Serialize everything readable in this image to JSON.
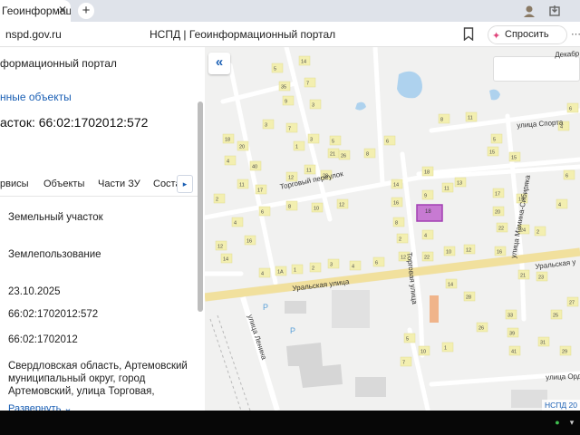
{
  "browser": {
    "tab_title": "Геоинформаци",
    "tab_close": "✕",
    "new_tab": "+",
    "url": "nspd.gov.ru",
    "page_title": "НСПД | Геоинформационный портал",
    "ask_label": "Спросить",
    "icons": [
      "profile-icon",
      "download-icon",
      "bookmark-icon",
      "assistant-icon"
    ]
  },
  "panel": {
    "portal_title": "формационный портал",
    "selected_link": "нные объекты",
    "title": "асток: 66:02:1702012:572",
    "tabs": [
      "рвисы",
      "Объекты",
      "Части ЗУ",
      "Соста"
    ],
    "tabs_more": "▸",
    "fields": {
      "type": "Земельный участок",
      "kind": "Землепользование",
      "date": "23.10.2025",
      "cadastral_number": "66:02:1702012:572",
      "quarter": "66:02:1702012",
      "address": "Свердловская область, Артемовский муниципальный округ, город Артемовский, улица Торговая,"
    },
    "expand_label": "Развернуть ⌄"
  },
  "map": {
    "collapse_label": "«",
    "footer": "НСПД 20",
    "streets": {
      "trade_lane": "Торговый переулок",
      "sport": "улица Спорта",
      "mamin": "улица Мамина-Сибиряка",
      "ural_left": "Уральская улица",
      "ural_right": "Уральская у",
      "trade_street": "Торговая улица",
      "lenin": "улица Ленина",
      "ordzh": "улица Орд",
      "dekabr": "Декабр"
    },
    "parcel_label": "18",
    "building_labels": [
      "5",
      "14",
      "35",
      "7",
      "9",
      "3",
      "3",
      "7",
      "1",
      "3",
      "5",
      "21",
      "4",
      "40",
      "11",
      "17",
      "12",
      "11",
      "28",
      "26",
      "8",
      "6",
      "8",
      "11",
      "5",
      "15",
      "6",
      "4",
      "2",
      "4",
      "6",
      "8",
      "10",
      "12",
      "14",
      "16",
      "18",
      "9",
      "11",
      "13",
      "15",
      "17",
      "19",
      "20",
      "22",
      "24",
      "2",
      "4",
      "6",
      "8",
      "2",
      "4",
      "22",
      "10",
      "12",
      "4",
      "1А",
      "1",
      "2",
      "3",
      "4",
      "6",
      "12",
      "14",
      "16",
      "21",
      "23",
      "25",
      "27",
      "29",
      "31",
      "33",
      "39",
      "41",
      "26",
      "28",
      "1",
      "5",
      "7",
      "10",
      "12",
      "14",
      "16",
      "18",
      "20",
      "22",
      "24",
      "26",
      "28",
      "30",
      "32",
      "34",
      "36",
      "38",
      "40",
      "42",
      "44",
      "46"
    ]
  },
  "colors": {
    "accent": "#1a5fb4",
    "parcel_fill": "#c77ad2",
    "parcel_border": "#a23fb3",
    "building": "#f3efb0",
    "road": "#ffffff",
    "main_road": "#f6e7a8",
    "water": "#aed2ee",
    "taskbar": "#070707"
  }
}
